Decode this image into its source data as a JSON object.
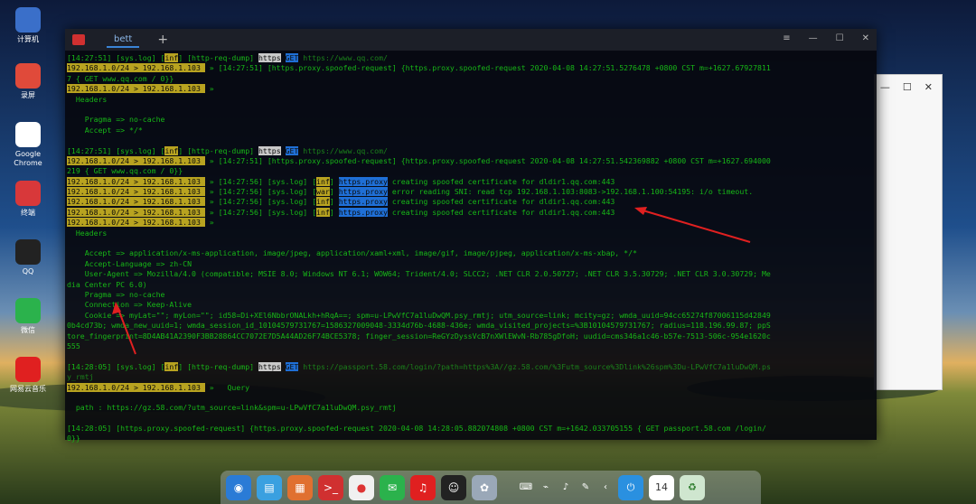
{
  "desktop": {
    "icons": [
      {
        "label": "计算机",
        "color": "#3a6fc9"
      },
      {
        "label": "录屏",
        "color": "#e04a3a"
      },
      {
        "label": "Google\nChrome",
        "color": "#ffffff"
      },
      {
        "label": "终端",
        "color": "#d8383a"
      },
      {
        "label": "QQ",
        "color": "#222222"
      },
      {
        "label": "微信",
        "color": "#2bb24c"
      },
      {
        "label": "网易云音乐",
        "color": "#e02020"
      }
    ]
  },
  "terminal": {
    "tab_label": "bett",
    "lines": [
      [
        {
          "t": "[14:27:51] [sys.log] "
        },
        {
          "t": "[",
          "c": ""
        },
        {
          "t": "inf",
          "c": "hl-y"
        },
        {
          "t": "] [http-req-dump] "
        },
        {
          "t": "https",
          "c": "hl-w"
        },
        {
          "t": " "
        },
        {
          "t": "GET",
          "c": "hl-b"
        },
        {
          "t": " https://www.qq.com/",
          "c": "dim"
        }
      ],
      [
        {
          "t": "192.168.1.0/24 > 192.168.1.103 ",
          "c": "hl-y"
        },
        {
          "t": " » [14:27:51] [https.proxy.spoofed-request] {https.proxy.spoofed-request 2020-04-08 14:27:51.5276478 +0800 CST m=+1627.67927811"
        }
      ],
      [
        {
          "t": "7 { GET www.qq.com / 0}}"
        }
      ],
      [
        {
          "t": "192.168.1.0/24 > 192.168.1.103 ",
          "c": "hl-y"
        },
        {
          "t": " »"
        }
      ],
      [
        {
          "t": "  Headers"
        }
      ],
      [
        {
          "t": ""
        }
      ],
      [
        {
          "t": "    Pragma => no-cache"
        }
      ],
      [
        {
          "t": "    Accept => */*"
        }
      ],
      [
        {
          "t": ""
        }
      ],
      [
        {
          "t": "[14:27:51] [sys.log] ["
        },
        {
          "t": "inf",
          "c": "hl-y"
        },
        {
          "t": "] [http-req-dump] "
        },
        {
          "t": "https",
          "c": "hl-w"
        },
        {
          "t": " "
        },
        {
          "t": "GET",
          "c": "hl-b"
        },
        {
          "t": " https://www.qq.com/",
          "c": "dim"
        }
      ],
      [
        {
          "t": "192.168.1.0/24 > 192.168.1.103 ",
          "c": "hl-y"
        },
        {
          "t": " » [14:27:51] [https.proxy.spoofed-request] {https.proxy.spoofed-request 2020-04-08 14:27:51.542369882 +0800 CST m=+1627.694000"
        }
      ],
      [
        {
          "t": "219 { GET www.qq.com / 0}}"
        }
      ],
      [
        {
          "t": "192.168.1.0/24 > 192.168.1.103 ",
          "c": "hl-y"
        },
        {
          "t": " » [14:27:56] [sys.log] ["
        },
        {
          "t": "inf",
          "c": "hl-y"
        },
        {
          "t": "] "
        },
        {
          "t": "https.proxy",
          "c": "hl-b"
        },
        {
          "t": " creating spoofed certificate for dldir1.qq.com:443"
        }
      ],
      [
        {
          "t": "192.168.1.0/24 > 192.168.1.103 ",
          "c": "hl-y"
        },
        {
          "t": " » [14:27:56] [sys.log] ["
        },
        {
          "t": "war",
          "c": "hl-y"
        },
        {
          "t": "] "
        },
        {
          "t": "https.proxy",
          "c": "hl-b"
        },
        {
          "t": " error reading SNI: read tcp 192.168.1.103:8083->192.168.1.100:54195: i/o timeout."
        }
      ],
      [
        {
          "t": "192.168.1.0/24 > 192.168.1.103 ",
          "c": "hl-y"
        },
        {
          "t": " » [14:27:56] [sys.log] ["
        },
        {
          "t": "inf",
          "c": "hl-y"
        },
        {
          "t": "] "
        },
        {
          "t": "https.proxy",
          "c": "hl-b"
        },
        {
          "t": " creating spoofed certificate for dldir1.qq.com:443"
        }
      ],
      [
        {
          "t": "192.168.1.0/24 > 192.168.1.103 ",
          "c": "hl-y"
        },
        {
          "t": " » [14:27:56] [sys.log] ["
        },
        {
          "t": "inf",
          "c": "hl-y"
        },
        {
          "t": "] "
        },
        {
          "t": "https.proxy",
          "c": "hl-b"
        },
        {
          "t": " creating spoofed certificate for dldir1.qq.com:443"
        }
      ],
      [
        {
          "t": "192.168.1.0/24 > 192.168.1.103 ",
          "c": "hl-y"
        },
        {
          "t": " »"
        }
      ],
      [
        {
          "t": "  Headers"
        }
      ],
      [
        {
          "t": ""
        }
      ],
      [
        {
          "t": "    Accept => application/x-ms-application, image/jpeg, application/xaml+xml, image/gif, image/pjpeg, application/x-ms-xbap, */*"
        }
      ],
      [
        {
          "t": "    Accept-Language => zh-CN"
        }
      ],
      [
        {
          "t": "    User-Agent => Mozilla/4.0 (compatible; MSIE 8.0; Windows NT 6.1; WOW64; Trident/4.0; SLCC2; .NET CLR 2.0.50727; .NET CLR 3.5.30729; .NET CLR 3.0.30729; Me"
        }
      ],
      [
        {
          "t": "dia Center PC 6.0)"
        }
      ],
      [
        {
          "t": "    Pragma => no-cache"
        }
      ],
      [
        {
          "t": "    Connection => Keep-Alive"
        }
      ],
      [
        {
          "t": "    Cookie => myLat=\"\"; myLon=\"\"; id58=Di+XEl6NbbrONALkh+hRqA==; spm=u-LPwVfC7a1luDwQM.psy_rmtj; utm_source=link; mcity=gz; wmda_uuid=94cc65274f87006115d42849"
        }
      ],
      [
        {
          "t": "0b4cd73b; wmda_new_uuid=1; wmda_session_id_10104579731767=1586327009048-3334d76b-4688-436e; wmda_visited_projects=%3B10104579731767; radius=118.196.99.87; ppS"
        }
      ],
      [
        {
          "t": "tore_fingerprint=8D4AB41A2390F3BB28864CC7072E7D5A44AD26F74BCE5378; finger_session=ReGYzDyssVcB7nXWlEWvN-Rb785gDfoH; uudid=cms346a1c46-b57e-7513-506c-954e1620c"
        }
      ],
      [
        {
          "t": "555"
        }
      ],
      [
        {
          "t": ""
        }
      ],
      [
        {
          "t": "[14:28:05] [sys.log] ["
        },
        {
          "t": "inf",
          "c": "hl-y"
        },
        {
          "t": "] [http-req-dump] "
        },
        {
          "t": "https",
          "c": "hl-w"
        },
        {
          "t": " "
        },
        {
          "t": "GET",
          "c": "hl-b"
        },
        {
          "t": " https://passport.58.com/login/?path=https%3A//gz.58.com/%3Futm_source%3Dlink%26spm%3Du-LPwVfC7a1luDwQM.ps",
          "c": "dim"
        }
      ],
      [
        {
          "t": "y_rmtj",
          "c": "dim"
        }
      ],
      [
        {
          "t": "192.168.1.0/24 > 192.168.1.103 ",
          "c": "hl-y"
        },
        {
          "t": " »   Query"
        }
      ],
      [
        {
          "t": ""
        }
      ],
      [
        {
          "t": "  path : https://gz.58.com/?utm_source=link&spm=u-LPwVfC7a1luDwQM.psy_rmtj"
        }
      ],
      [
        {
          "t": ""
        }
      ],
      [
        {
          "t": "[14:28:05] [https.proxy.spoofed-request] {https.proxy.spoofed-request 2020-04-08 14:28:05.882074808 +0800 CST m=+1642.033705155 { GET passport.58.com /login/"
        }
      ],
      [
        {
          "t": "0}}"
        }
      ]
    ]
  },
  "dock": {
    "items": [
      {
        "icon": "launcher-icon",
        "color": "#2a7bd6",
        "glyph": "◉"
      },
      {
        "icon": "file-manager-icon",
        "color": "#3aa0e0",
        "glyph": "▤"
      },
      {
        "icon": "app-store-icon",
        "color": "#e07030",
        "glyph": "▦"
      },
      {
        "icon": "terminal-icon",
        "color": "#d03030",
        "glyph": ">_"
      },
      {
        "icon": "chrome-icon",
        "color": "#f0f0f0",
        "glyph": "●"
      },
      {
        "icon": "wechat-icon",
        "color": "#2bb24c",
        "glyph": "✉"
      },
      {
        "icon": "netease-music-icon",
        "color": "#e02020",
        "glyph": "♫"
      },
      {
        "icon": "qq-icon",
        "color": "#222222",
        "glyph": "☺"
      },
      {
        "icon": "settings-icon",
        "color": "#9aa8b8",
        "glyph": "✿"
      }
    ],
    "tray": [
      "⌨",
      "⌁",
      "♪",
      "✎",
      "‹"
    ],
    "right_items": [
      {
        "icon": "power-icon",
        "color": "#2a90e0",
        "glyph": "⏻"
      },
      {
        "icon": "calendar-icon",
        "color": "#ffffff",
        "glyph": "14"
      },
      {
        "icon": "trash-icon",
        "color": "#cfe6cf",
        "glyph": "♻"
      }
    ]
  }
}
